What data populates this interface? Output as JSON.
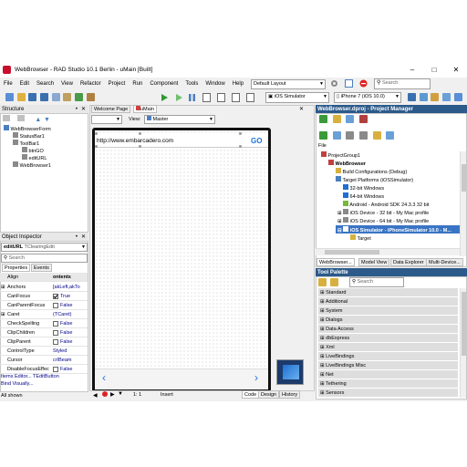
{
  "window": {
    "title": "WebBrowser - RAD Studio 10.1 Berlin - uMain [Built]"
  },
  "menu": [
    "File",
    "Edit",
    "Search",
    "View",
    "Refactor",
    "Project",
    "Run",
    "Component",
    "Tools",
    "Window",
    "Help"
  ],
  "layout_combo": "Default Layout",
  "search_placeholder": "Search",
  "platform_combo": "iOS Simulator",
  "device_combo": "iPhone 7 (iOS 10.0)",
  "structure": {
    "title": "Structure",
    "items": [
      "WebBrowserForm",
      "StatusBar1",
      "ToolBar1",
      "btnGO",
      "editURL",
      "WebBrowser1"
    ]
  },
  "object_inspector": {
    "title": "Object Inspector",
    "selected_name": "editURL",
    "selected_type": "TClearingEdit",
    "search_placeholder": "Search",
    "tabs": [
      "Properties",
      "Events"
    ],
    "col_align": "Align",
    "col_contents": "ontents",
    "rows": [
      {
        "name": "Anchors",
        "value": "[akLeft,akTo"
      },
      {
        "name": "CanFocus",
        "value": "True"
      },
      {
        "name": "CanParentFocus",
        "value": "False"
      },
      {
        "name": "Caret",
        "value": "(TCaret)"
      },
      {
        "name": "CheckSpelling",
        "value": "False"
      },
      {
        "name": "ClipChildren",
        "value": "False"
      },
      {
        "name": "ClipParent",
        "value": "False"
      },
      {
        "name": "ControlType",
        "value": "Styled"
      },
      {
        "name": "Cursor",
        "value": "crIBeam"
      },
      {
        "name": "DisableFocusEffec",
        "value": "False"
      }
    ],
    "footer1": "Items Editor...  TEditButton",
    "footer2": "Bind Visually...",
    "status": "All shown"
  },
  "editor": {
    "tabs": [
      "Welcome Page",
      "uMain"
    ],
    "view_label": "View:",
    "view_value": "Master",
    "url_text": "http://www.embarcadero.com",
    "go_label": "GO",
    "position": "1:   1",
    "mode": "Insert",
    "bottom_tabs": [
      "Code",
      "Design",
      "History"
    ]
  },
  "project_manager": {
    "title": "WebBrowser.dproj - Project Manager",
    "file_label": "File",
    "tree": [
      "ProjectGroup1",
      "WebBrowser",
      "Build Configurations (Debug)",
      "Target Platforms (iOSSimulator)",
      "32-bit Windows",
      "64-bit Windows",
      "Android - Android SDK 24.3.3 32 bit",
      "iOS Device - 32 bit - My Mac profile",
      "iOS Device - 64 bit - My Mac profile",
      "iOS Simulator - iPhoneSimulator 10.0 - M...",
      "Target"
    ],
    "tabs": [
      "WebBrowser...",
      "Model View",
      "Data Explorer",
      "Multi-Device..."
    ]
  },
  "tool_palette": {
    "title": "Tool Palette",
    "search_placeholder": "Search",
    "categories": [
      "Standard",
      "Additional",
      "System",
      "Dialogs",
      "Data Access",
      "dbExpress",
      "Xml",
      "LiveBindings",
      "LiveBindings Misc",
      "Net",
      "Tethering",
      "Sensors"
    ]
  },
  "colors": {
    "accent": "#2c5a8a",
    "selection": "#3a74c4",
    "stop_red": "#e02020",
    "run_green": "#2e9a2e"
  }
}
